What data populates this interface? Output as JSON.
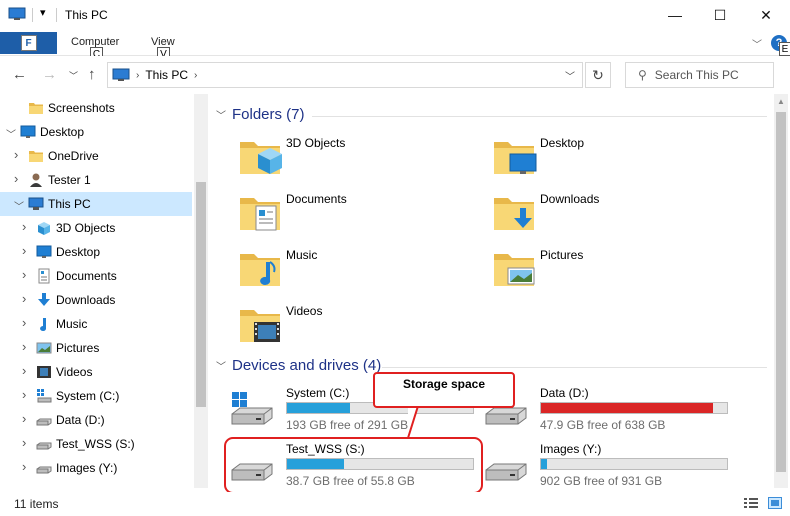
{
  "window": {
    "title": "This PC",
    "minimize": "—",
    "maximize": "☐",
    "close": "✕"
  },
  "ribbon": {
    "file_key": "F",
    "tabs": [
      {
        "label": "Computer",
        "key": "C"
      },
      {
        "label": "View",
        "key": "V"
      }
    ],
    "help_label": "?",
    "help_key": "E"
  },
  "nav": {
    "address": "This PC",
    "search_placeholder": "Search This PC"
  },
  "tree": [
    {
      "label": "Screenshots",
      "icon": "folder-icon",
      "level": 1,
      "expander": ""
    },
    {
      "label": "Desktop",
      "icon": "desktop-icon",
      "level": 0,
      "expander": "expanded"
    },
    {
      "label": "OneDrive",
      "icon": "folder-icon",
      "level": 1,
      "expander": "collapsed"
    },
    {
      "label": "Tester 1",
      "icon": "user-icon",
      "level": 1,
      "expander": "collapsed"
    },
    {
      "label": "This PC",
      "icon": "pc-icon",
      "level": 1,
      "expander": "expanded",
      "selected": true
    },
    {
      "label": "3D Objects",
      "icon": "cube-icon",
      "level": 2,
      "expander": "collapsed"
    },
    {
      "label": "Desktop",
      "icon": "desktop-icon",
      "level": 2,
      "expander": "collapsed"
    },
    {
      "label": "Documents",
      "icon": "document-icon",
      "level": 2,
      "expander": "collapsed"
    },
    {
      "label": "Downloads",
      "icon": "download-icon",
      "level": 2,
      "expander": "collapsed"
    },
    {
      "label": "Music",
      "icon": "music-icon",
      "level": 2,
      "expander": "collapsed"
    },
    {
      "label": "Pictures",
      "icon": "picture-icon",
      "level": 2,
      "expander": "collapsed"
    },
    {
      "label": "Videos",
      "icon": "video-icon",
      "level": 2,
      "expander": "collapsed"
    },
    {
      "label": "System (C:)",
      "icon": "system-drive-icon",
      "level": 2,
      "expander": "collapsed"
    },
    {
      "label": "Data (D:)",
      "icon": "drive-icon",
      "level": 2,
      "expander": "collapsed"
    },
    {
      "label": "Test_WSS (S:)",
      "icon": "drive-icon",
      "level": 2,
      "expander": "collapsed"
    },
    {
      "label": "Images (Y:)",
      "icon": "drive-icon",
      "level": 2,
      "expander": "collapsed"
    }
  ],
  "folders_header": "Folders (7)",
  "folders": [
    {
      "label": "3D Objects",
      "icon": "cube-icon"
    },
    {
      "label": "Desktop",
      "icon": "desktop-icon"
    },
    {
      "label": "Documents",
      "icon": "document-icon"
    },
    {
      "label": "Downloads",
      "icon": "download-icon"
    },
    {
      "label": "Music",
      "icon": "music-icon"
    },
    {
      "label": "Pictures",
      "icon": "picture-icon"
    },
    {
      "label": "Videos",
      "icon": "video-icon"
    }
  ],
  "drives_header": "Devices and drives (4)",
  "drives": [
    {
      "name": "System (C:)",
      "free": "193 GB free of 291 GB",
      "used_fraction": 0.337,
      "full": false,
      "icon": "system-drive-icon"
    },
    {
      "name": "Data (D:)",
      "free": "47.9 GB free of 638 GB",
      "used_fraction": 0.925,
      "full": true,
      "icon": "drive-icon"
    },
    {
      "name": "Test_WSS (S:)",
      "free": "38.7 GB free of 55.8 GB",
      "used_fraction": 0.306,
      "full": false,
      "icon": "drive-icon"
    },
    {
      "name": "Images (Y:)",
      "free": "902 GB free of 931 GB",
      "used_fraction": 0.031,
      "full": false,
      "icon": "drive-icon"
    }
  ],
  "annotation": {
    "label": "Storage space",
    "color": "#e02020"
  },
  "status": {
    "items": "11 items"
  },
  "colors": {
    "accent": "#1e5ea8",
    "bar": "#26a0da",
    "bar_full": "#da2626",
    "selected": "#cce8ff",
    "header": "#1e3287"
  }
}
